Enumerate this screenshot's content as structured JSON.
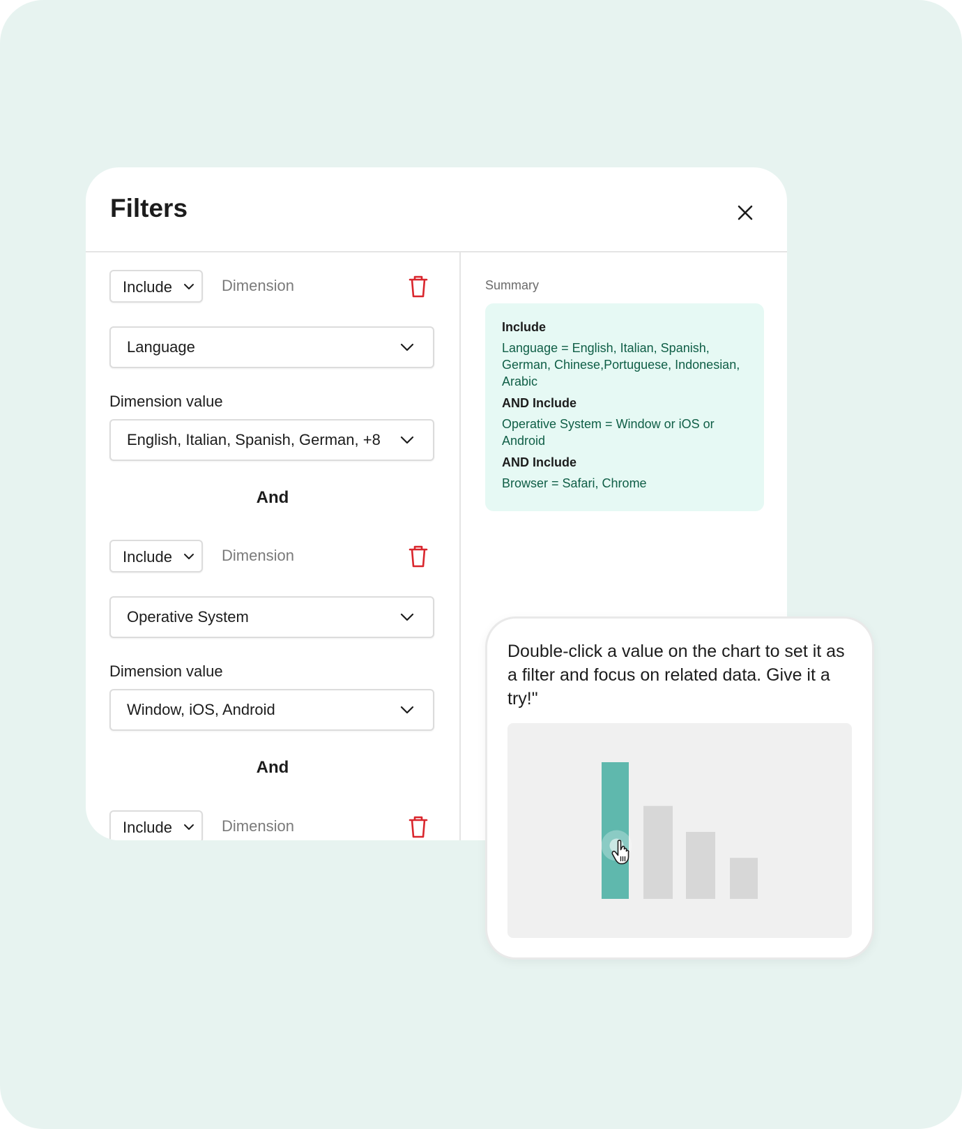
{
  "modal": {
    "title": "Filters"
  },
  "filters": [
    {
      "mode": "Include",
      "dimension_placeholder": "Dimension",
      "dimension": "Language",
      "value_label": "Dimension value",
      "values": "English, Italian, Spanish, German, +8"
    },
    {
      "mode": "Include",
      "dimension_placeholder": "Dimension",
      "dimension": "Operative System",
      "value_label": "Dimension value",
      "values": "Window, iOS, Android"
    },
    {
      "mode": "Include",
      "dimension_placeholder": "Dimension"
    }
  ],
  "connector": "And",
  "summary": {
    "title": "Summary",
    "items": [
      {
        "head": "Include",
        "value": "Language = English, Italian, Spanish, German, Chinese,Portuguese, Indonesian, Arabic"
      },
      {
        "head": "AND Include",
        "value": "Operative System = Window or iOS or Android"
      },
      {
        "head": "AND Include",
        "value": "Browser = Safari, Chrome"
      }
    ]
  },
  "tip": {
    "text": "Double-click a value on the chart to set it as a filter and focus on related data. Give it a try!\""
  },
  "chart_data": {
    "type": "bar",
    "categories": [
      "",
      "",
      "",
      ""
    ],
    "values": [
      100,
      68,
      49,
      30
    ],
    "highlight_index": 0,
    "ylim": [
      0,
      100
    ]
  },
  "colors": {
    "background": "#e7f3f0",
    "delete": "#d9262d",
    "summary_bg": "#e6f9f4",
    "summary_text": "#0f5e46",
    "bar_highlight": "#5fb8ad",
    "bar_default": "#d7d7d7"
  },
  "icons": {
    "close": "close-icon",
    "delete": "trash-icon",
    "dropdown": "chevron-down-icon",
    "cursor": "hand-pointer-icon"
  }
}
